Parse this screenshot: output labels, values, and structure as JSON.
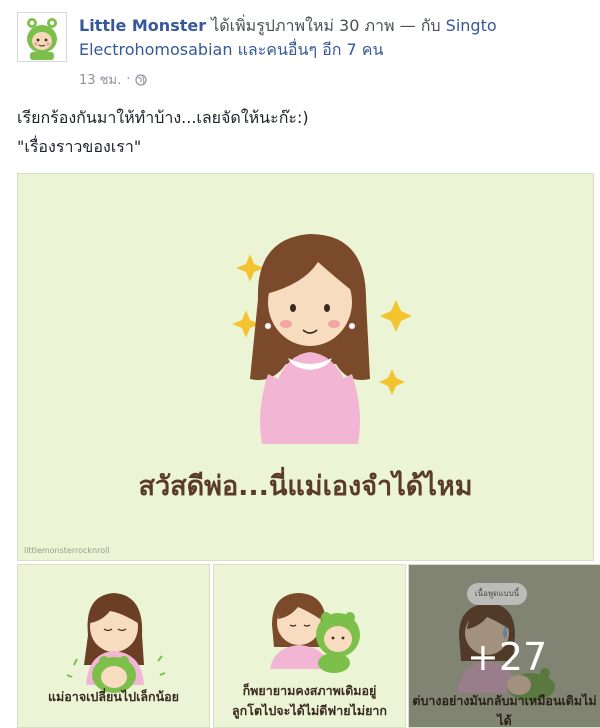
{
  "post": {
    "author": "Little Monster",
    "action": "ได้เพิ่มรูปภาพใหม่ 30 ภาพ",
    "with_text": "— กับ",
    "tagged": "Singto Electrohomosabian",
    "and_others": "และคนอื่นๆ อีก 7 คน",
    "time": "13 ชม.",
    "separator": "·",
    "message_line1": "เรียกร้องกันมาให้ทำบ้าง...เลยจัดให้นะก๊ะ:)",
    "message_line2": "\"เรื่องราวของเรา\""
  },
  "photos": {
    "main_caption": "สวัสดีพ่อ...นี่แม่เองจำได้ไหม",
    "watermark": "littlemonsterrocknroll",
    "thumb1_caption": "แม่อาจเปลี่ยนไปเล็กน้อย",
    "thumb2_caption_line1": "ก็พยายามคงสภาพเดิมอยู่",
    "thumb2_caption_line2": "ลูกโตไปจะได้ไม่ดีฟายไม่ยาก",
    "thumb3_bubble": "เนื้อพูดแบบนี้",
    "thumb3_caption": "ต่บางอย่างมันกลับมาเหมือนเดิมไม่ได้",
    "more_count": "+27"
  },
  "colors": {
    "link": "#365899",
    "photo_bg": "#ebf5d6",
    "caption_brown": "#5a3a28",
    "meta_gray": "#90949c"
  },
  "icons": {
    "privacy": "globe-icon",
    "avatar": "green-monster-avatar"
  }
}
